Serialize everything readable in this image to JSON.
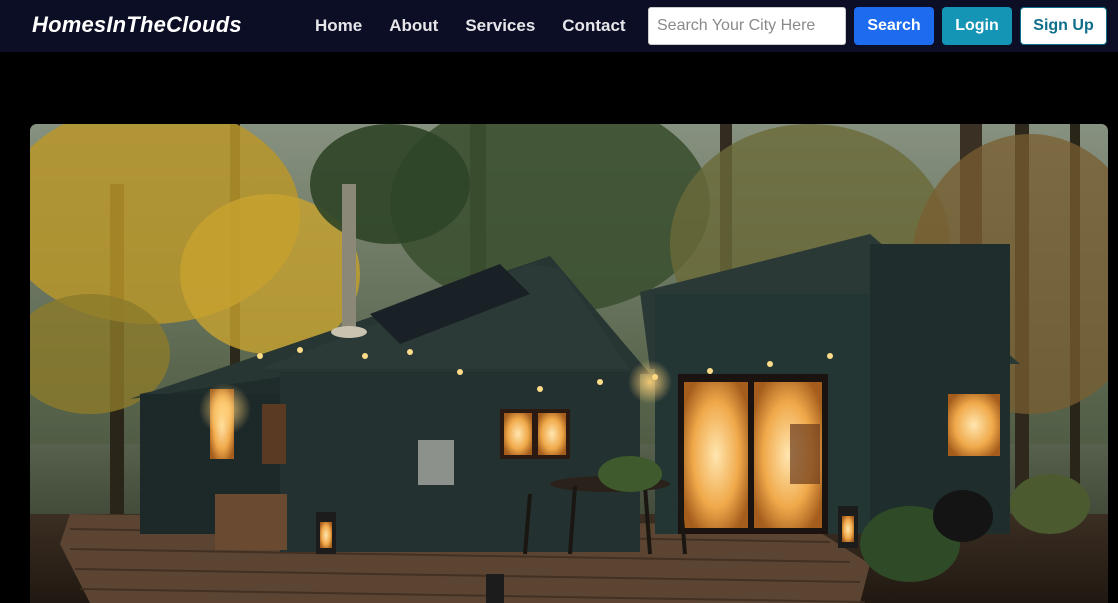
{
  "brand": {
    "name": "HomesInTheClouds"
  },
  "nav": {
    "links": [
      {
        "label": "Home"
      },
      {
        "label": "About"
      },
      {
        "label": "Services"
      },
      {
        "label": "Contact"
      }
    ]
  },
  "search": {
    "placeholder": "Search Your City Here",
    "value": "",
    "button_label": "Search"
  },
  "auth": {
    "login_label": "Login",
    "signup_label": "Sign Up"
  },
  "colors": {
    "navbar_bg": "#0b0e24",
    "page_bg": "#000000",
    "search_button": "#1d6cf0",
    "login_button": "#1495b5",
    "signup_text": "#0d6f8a"
  }
}
